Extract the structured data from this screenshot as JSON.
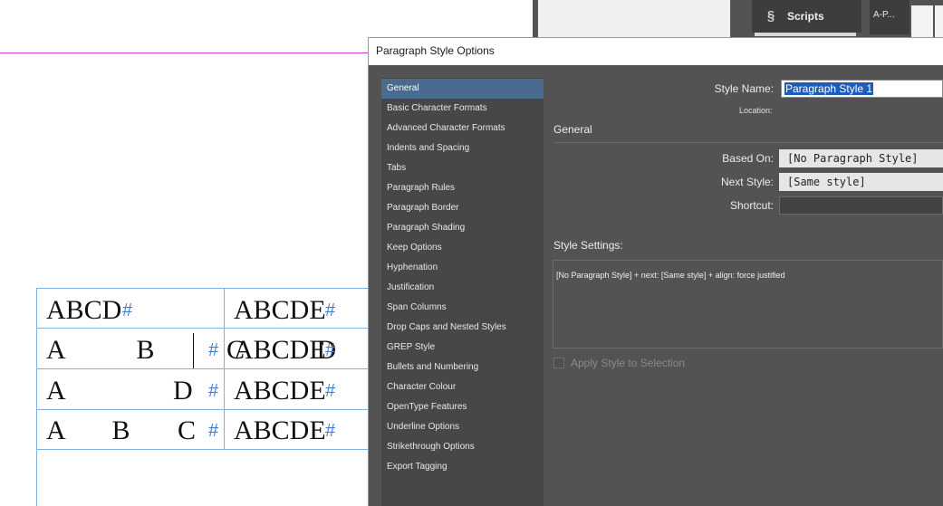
{
  "panels": {
    "scripts_label": "Scripts",
    "scripts_icon": "scripts-icon",
    "ap_label": "A-P..."
  },
  "document": {
    "rows": [
      {
        "left": "ABCD",
        "right": "ABCDE"
      },
      {
        "left": "A   B   C   D",
        "right": "ABCDE"
      },
      {
        "left": "A                D",
        "right": "ABCDE"
      },
      {
        "left": "A       B       C",
        "right": "ABCDE"
      }
    ],
    "end_mark": "#"
  },
  "dialog": {
    "title": "Paragraph Style Options",
    "nav_items": [
      "General",
      "Basic Character Formats",
      "Advanced Character Formats",
      "Indents and Spacing",
      "Tabs",
      "Paragraph Rules",
      "Paragraph Border",
      "Paragraph Shading",
      "Keep Options",
      "Hyphenation",
      "Justification",
      "Span Columns",
      "Drop Caps and Nested Styles",
      "GREP Style",
      "Bullets and Numbering",
      "Character Colour",
      "OpenType Features",
      "Underline Options",
      "Strikethrough Options",
      "Export Tagging"
    ],
    "selected_nav": "General",
    "style_name_label": "Style Name:",
    "style_name_value": "Paragraph Style 1",
    "location_label": "Location:",
    "section_heading": "General",
    "based_on_label": "Based On:",
    "based_on_value": "[No Paragraph Style]",
    "next_style_label": "Next Style:",
    "next_style_value": "[Same style]",
    "shortcut_label": "Shortcut:",
    "shortcut_value": "",
    "style_settings_label": "Style Settings:",
    "style_settings_text": "[No Paragraph Style] + next: [Same style] + align: force justified",
    "apply_label": "Apply Style to Selection",
    "apply_checked": false
  },
  "colors": {
    "selection_blue": "#4b6a8f",
    "guide_magenta": "#d33fd3",
    "frame_blue": "#7fb1e5",
    "hidden_char_blue": "#3f7fd6"
  }
}
